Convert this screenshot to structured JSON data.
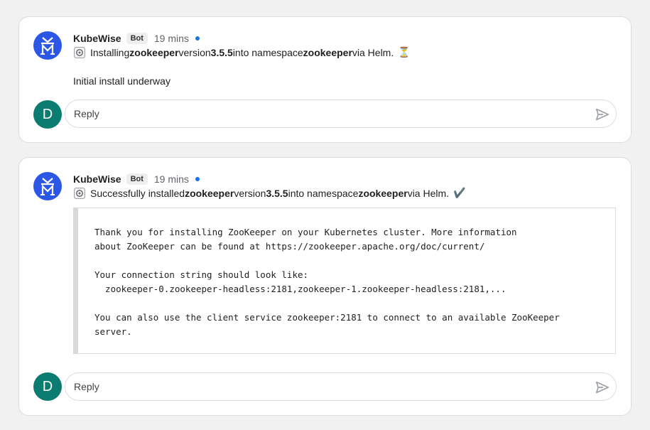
{
  "messages": [
    {
      "sender": "KubeWise",
      "badge": "Bot",
      "time": "19 mins",
      "line": {
        "pre": "Installing ",
        "chart": "zookeeper",
        "mid1": " version ",
        "version": "3.5.5",
        "mid2": " into namespace ",
        "namespace": "zookeeper",
        "post": " via Helm.",
        "status_icon": "⏳"
      },
      "text": "Initial install underway",
      "reply_placeholder": "Reply",
      "user_initial": "D"
    },
    {
      "sender": "KubeWise",
      "badge": "Bot",
      "time": "19 mins",
      "line": {
        "pre": "Successfully installed ",
        "chart": "zookeeper",
        "mid1": " version ",
        "version": "3.5.5",
        "mid2": " into namespace ",
        "namespace": "zookeeper",
        "post": " via Helm.",
        "status_icon": "✔️"
      },
      "notes": "Thank you for installing ZooKeeper on your Kubernetes cluster. More information\nabout ZooKeeper can be found at https://zookeeper.apache.org/doc/current/\n\nYour connection string should look like:\n  zookeeper-0.zookeeper-headless:2181,zookeeper-1.zookeeper-headless:2181,...\n\nYou can also use the client service zookeeper:2181 to connect to an available ZooKeeper\nserver.",
      "reply_placeholder": "Reply",
      "user_initial": "D"
    }
  ],
  "colors": {
    "bot_avatar": "#2b56e6",
    "user_avatar": "#0b7d70",
    "unread_dot": "#1a73e8"
  },
  "icons": [
    "kubewise-logo-icon",
    "helm-icon",
    "hourglass-icon",
    "checkmark-icon",
    "send-icon"
  ]
}
